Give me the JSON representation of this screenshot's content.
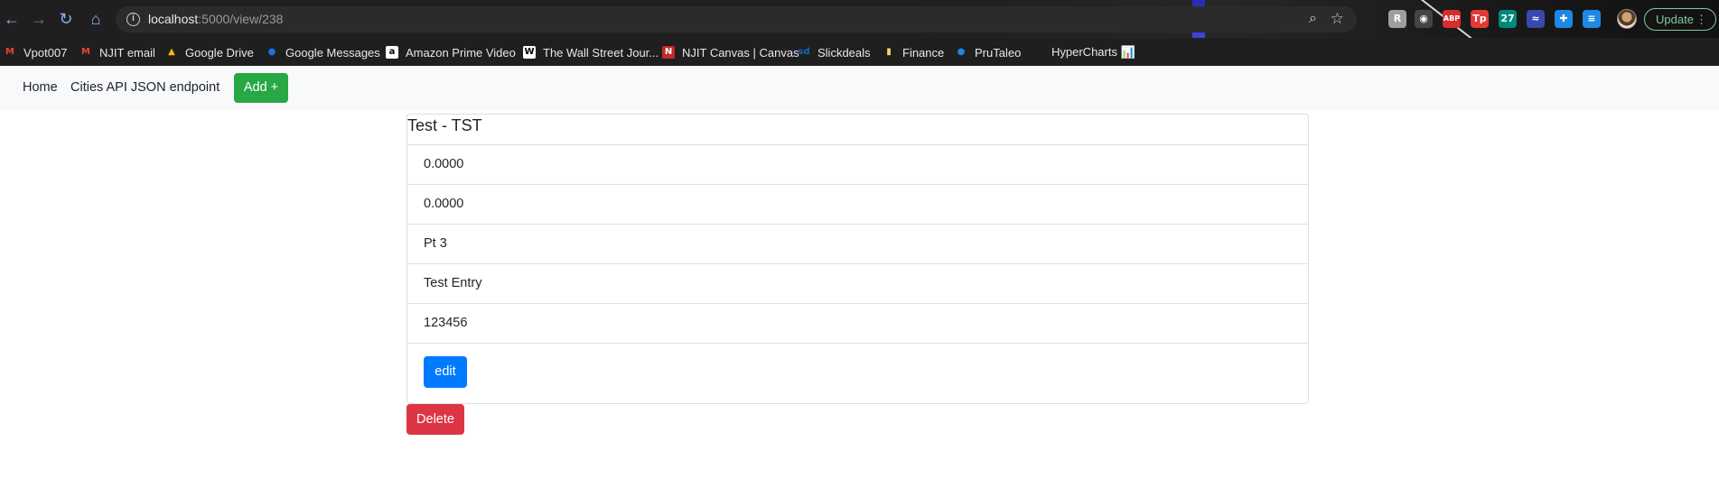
{
  "browser": {
    "url_host": "localhost",
    "url_path": ":5000/view/238",
    "update_label": "Update",
    "extensions": [
      {
        "name": "reader-extension-icon",
        "glyph": "R",
        "color": "#9e9e9e"
      },
      {
        "name": "lens-extension-icon",
        "glyph": "◉",
        "color": "#444444"
      },
      {
        "name": "adblock-plus-icon",
        "glyph": "ABP",
        "color": "#d32f2f"
      },
      {
        "name": "tp-extension-icon",
        "glyph": "Tp",
        "color": "#e53935"
      },
      {
        "name": "27-extension-icon",
        "glyph": "27",
        "color": "#00897b"
      },
      {
        "name": "wave-extension-icon",
        "glyph": "≈",
        "color": "#3949ab"
      },
      {
        "name": "puzzle-extensions-icon",
        "glyph": "✚",
        "color": "#1e88e5"
      },
      {
        "name": "reading-list-icon",
        "glyph": "≡",
        "color": "#1e88e5"
      }
    ]
  },
  "bookmarks": [
    {
      "label": "Vpot007",
      "icon": "gmail-icon",
      "glyph": "M",
      "color": "#ea4335"
    },
    {
      "label": "NJIT email",
      "icon": "gmail-icon",
      "glyph": "M",
      "color": "#ea4335"
    },
    {
      "label": "Google Drive",
      "icon": "google-drive-icon",
      "glyph": "▲",
      "color": "#fbbc04"
    },
    {
      "label": "Google Messages",
      "icon": "google-messages-icon",
      "glyph": "●",
      "color": "#1a73e8"
    },
    {
      "label": "Amazon Prime Video",
      "icon": "amazon-icon",
      "glyph": "a",
      "color": "#232f3e"
    },
    {
      "label": "The Wall Street Jour...",
      "icon": "wsj-icon",
      "glyph": "W",
      "color": "#ffffff"
    },
    {
      "label": "NJIT Canvas | Canvas",
      "icon": "njit-canvas-icon",
      "glyph": "N",
      "color": "#c62828"
    },
    {
      "label": "Slickdeals",
      "icon": "slickdeals-icon",
      "glyph": "sd",
      "color": "#1565c0"
    },
    {
      "label": "Finance",
      "icon": "folder-icon",
      "glyph": "▮",
      "color": "#fdd663"
    },
    {
      "label": "PruTaleo",
      "icon": "globe-icon",
      "glyph": "●",
      "color": "#1e88e5"
    },
    {
      "label": "HyperCharts 📊",
      "icon": "hypercharts-icon",
      "glyph": "X",
      "color": "#1f1f1f"
    }
  ],
  "navbar": {
    "home": "Home",
    "cities_api": "Cities API JSON endpoint",
    "add": "Add +"
  },
  "record": {
    "title": "Test - TST",
    "fields": [
      "0.0000",
      "0.0000",
      "Pt 3",
      "Test Entry",
      "123456"
    ],
    "edit_label": "edit",
    "delete_label": "Delete"
  }
}
